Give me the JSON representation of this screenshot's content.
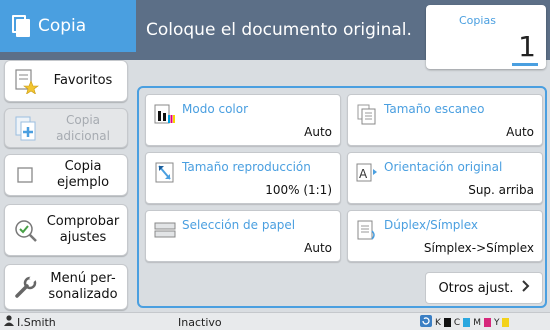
{
  "header": {
    "app_title": "Copia",
    "message": "Coloque el documento original.",
    "copies_label": "Copias",
    "copies_value": "1"
  },
  "sidebar": {
    "items": [
      {
        "label": "Favoritos",
        "enabled": true
      },
      {
        "label": "Copia adicional",
        "enabled": false
      },
      {
        "label": "Copia ejemplo",
        "enabled": true
      },
      {
        "label": "Comprobar ajustes",
        "enabled": true
      },
      {
        "label": "Menú per-sonalizado",
        "enabled": true
      }
    ]
  },
  "tiles": {
    "modo_color": {
      "name": "Modo color",
      "value": "Auto"
    },
    "tamano_escaneo": {
      "name": "Tamaño escaneo",
      "value": "Auto"
    },
    "tamano_reproduccion": {
      "name": "Tamaño reproducción",
      "value": "100% (1:1)"
    },
    "orientacion_original": {
      "name": "Orientación original",
      "value": "Sup. arriba"
    },
    "seleccion_papel": {
      "name": "Selección de papel",
      "value": "Auto"
    },
    "duplex_simplex": {
      "name": "Dúplex/Símplex",
      "value": "Símplex->Símplex"
    }
  },
  "otros_button": "Otros ajust.",
  "status": {
    "user": "I.Smith",
    "state": "Inactivo",
    "toner": [
      "K",
      "C",
      "M",
      "Y"
    ]
  },
  "colors": {
    "accent": "#4a9fe0",
    "header_bg": "#5c6f87",
    "panel_bg": "#d9dde1"
  }
}
